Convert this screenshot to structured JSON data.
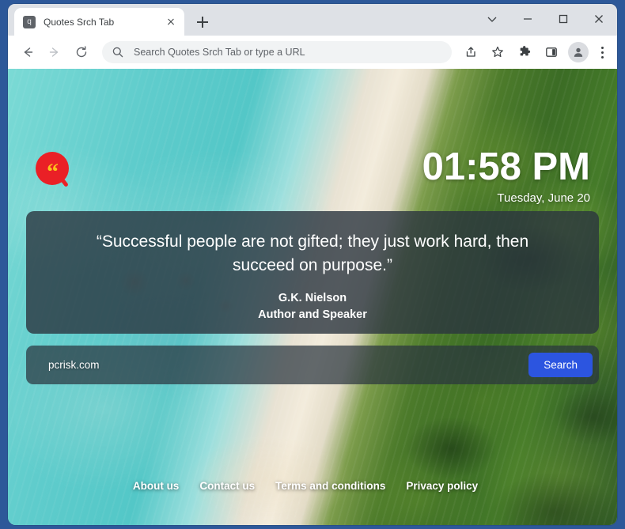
{
  "browser": {
    "tab": {
      "title": "Quotes Srch Tab",
      "favicon_letter": "q",
      "favicon_name": "quotes-srch-tab-favicon",
      "close_icon": "close-icon"
    },
    "new_tab_icon": "plus-icon",
    "window_controls": [
      {
        "name": "tab-search-button",
        "icon": "chevron-down-icon"
      },
      {
        "name": "minimize-button",
        "icon": "minimize-icon"
      },
      {
        "name": "maximize-button",
        "icon": "maximize-icon"
      },
      {
        "name": "close-window-button",
        "icon": "close-icon"
      }
    ],
    "toolbar": {
      "back_icon": "back-arrow-icon",
      "forward_icon": "forward-arrow-icon",
      "reload_icon": "reload-icon",
      "omnibox": {
        "search_icon": "search-icon",
        "placeholder": "Search Quotes Srch Tab or type a URL",
        "value": ""
      },
      "share_icon": "share-icon",
      "bookmark_icon": "star-icon",
      "extensions_icon": "puzzle-piece-icon",
      "side_panel_icon": "side-panel-icon",
      "profile_icon": "person-avatar-icon",
      "menu_icon": "three-dot-menu-icon"
    }
  },
  "page": {
    "logo": {
      "name": "quotes-srch-tab-logo",
      "glyph": "“",
      "circle_color": "#ea2026",
      "quote_color": "#fcc21b"
    },
    "clock": {
      "time": "01:58 PM",
      "date": "Tuesday, June 20"
    },
    "quote": {
      "text": "“Successful people are not gifted; they just work hard, then succeed on purpose.”",
      "author": "G.K. Nielson",
      "role": "Author and Speaker"
    },
    "search": {
      "value": "pcrisk.com",
      "placeholder": "",
      "button_label": "Search",
      "button_color": "#2c55e0"
    },
    "footer": {
      "links": [
        {
          "label": "About us",
          "name": "footer-link-about-us"
        },
        {
          "label": "Contact us",
          "name": "footer-link-contact-us"
        },
        {
          "label": "Terms and conditions",
          "name": "footer-link-terms-and-conditions"
        },
        {
          "label": "Privacy policy",
          "name": "footer-link-privacy-policy"
        }
      ]
    }
  }
}
